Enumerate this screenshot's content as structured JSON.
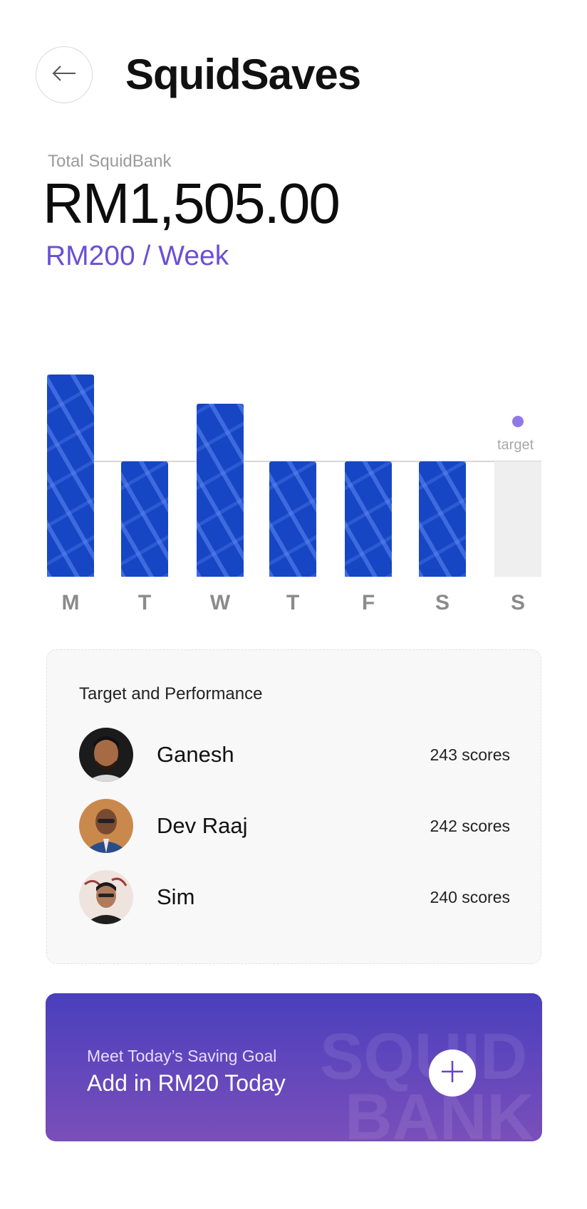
{
  "header": {
    "title": "SquidSaves",
    "back_icon": "arrow-left-icon"
  },
  "summary": {
    "total_label": "Total SquidBank",
    "total_amount": "RM1,505.00",
    "rate": "RM200 / Week"
  },
  "chart_data": {
    "type": "bar",
    "categories": [
      "M",
      "T",
      "W",
      "T",
      "F",
      "S",
      "S"
    ],
    "values": [
      1.75,
      1.0,
      1.5,
      1.0,
      1.0,
      1.0,
      0
    ],
    "target": 1.0,
    "target_label": "target",
    "colors": {
      "bar": "#1646c4",
      "empty": "#efefef",
      "target_dot": "#8f79e6"
    }
  },
  "performance": {
    "title": "Target and Performance",
    "rows": [
      {
        "name": "Ganesh",
        "score": "243 scores"
      },
      {
        "name": "Dev Raaj",
        "score": "242 scores"
      },
      {
        "name": "Sim",
        "score": "240 scores"
      }
    ]
  },
  "goal": {
    "subtitle": "Meet Today’s Saving Goal",
    "title": "Add in RM20 Today",
    "watermark_line1": "SQUID",
    "watermark_line2": "BANK",
    "add_icon": "plus-icon"
  },
  "colors": {
    "accent": "#6a4fd6",
    "bar": "#1646c4"
  }
}
